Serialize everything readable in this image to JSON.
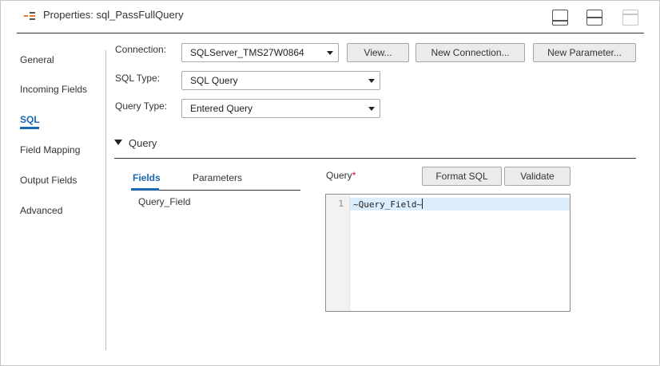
{
  "header": {
    "title": "Properties: sql_PassFullQuery",
    "icon": "transformation-icon"
  },
  "nav": {
    "items": [
      {
        "label": "General",
        "active": false
      },
      {
        "label": "Incoming Fields",
        "active": false
      },
      {
        "label": "SQL",
        "active": true
      },
      {
        "label": "Field Mapping",
        "active": false
      },
      {
        "label": "Output Fields",
        "active": false
      },
      {
        "label": "Advanced",
        "active": false
      }
    ]
  },
  "form": {
    "connection": {
      "label": "Connection:",
      "value": "SQLServer_TMS27W0864",
      "buttons": {
        "view": "View...",
        "new_connection": "New Connection...",
        "new_parameter": "New Parameter..."
      }
    },
    "sql_type": {
      "label": "SQL Type:",
      "value": "SQL Query"
    },
    "query_type": {
      "label": "Query Type:",
      "value": "Entered Query"
    }
  },
  "query_section": {
    "title": "Query",
    "tabs": [
      {
        "label": "Fields",
        "active": true
      },
      {
        "label": "Parameters",
        "active": false
      }
    ],
    "fields": [
      "Query_Field"
    ],
    "editor": {
      "label": "Query",
      "required_marker": "*",
      "format_button": "Format SQL",
      "validate_button": "Validate",
      "lines": [
        {
          "number": "1",
          "text": "~Query_Field~"
        }
      ]
    }
  },
  "colors": {
    "accent": "#1a67b3",
    "required": "#d0021b",
    "line_highlight": "#dceefc",
    "button_bg": "#ebebeb"
  }
}
